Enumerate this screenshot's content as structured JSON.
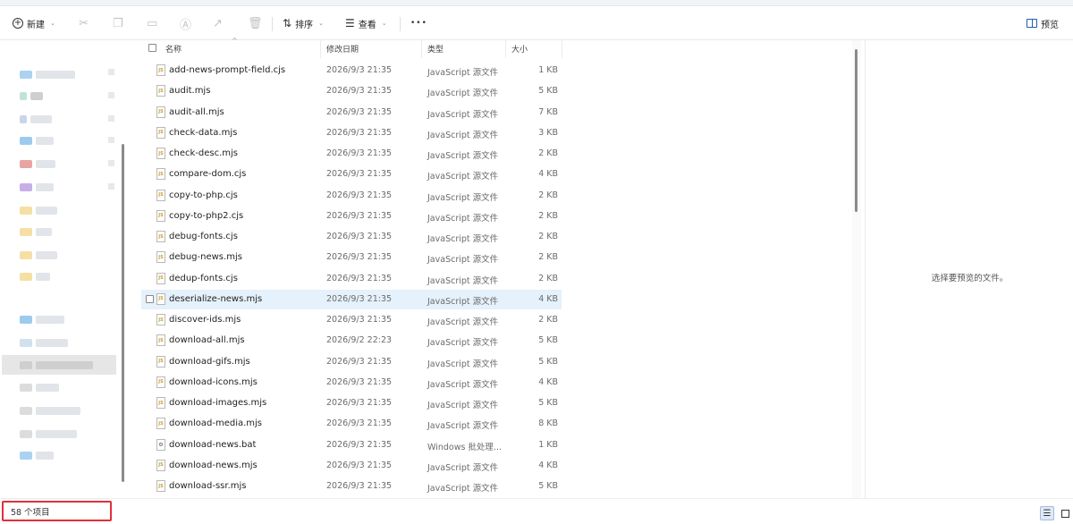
{
  "toolbar": {
    "new_label": "新建",
    "sort_label": "排序",
    "view_label": "查看",
    "more_label": "•••",
    "preview_label": "预览"
  },
  "columns": {
    "name": "名称",
    "date": "修改日期",
    "type": "类型",
    "size": "大小"
  },
  "files": [
    {
      "name": "add-news-prompt-field.cjs",
      "date": "2026/9/3 21:35",
      "type": "JavaScript 源文件",
      "size": "1 KB",
      "icon": "js-file-icon"
    },
    {
      "name": "audit.mjs",
      "date": "2026/9/3 21:35",
      "type": "JavaScript 源文件",
      "size": "5 KB",
      "icon": "js-file-icon"
    },
    {
      "name": "audit-all.mjs",
      "date": "2026/9/3 21:35",
      "type": "JavaScript 源文件",
      "size": "7 KB",
      "icon": "js-file-icon"
    },
    {
      "name": "check-data.mjs",
      "date": "2026/9/3 21:35",
      "type": "JavaScript 源文件",
      "size": "3 KB",
      "icon": "js-file-icon"
    },
    {
      "name": "check-desc.mjs",
      "date": "2026/9/3 21:35",
      "type": "JavaScript 源文件",
      "size": "2 KB",
      "icon": "js-file-icon"
    },
    {
      "name": "compare-dom.cjs",
      "date": "2026/9/3 21:35",
      "type": "JavaScript 源文件",
      "size": "4 KB",
      "icon": "js-file-icon"
    },
    {
      "name": "copy-to-php.cjs",
      "date": "2026/9/3 21:35",
      "type": "JavaScript 源文件",
      "size": "2 KB",
      "icon": "js-file-icon"
    },
    {
      "name": "copy-to-php2.cjs",
      "date": "2026/9/3 21:35",
      "type": "JavaScript 源文件",
      "size": "2 KB",
      "icon": "js-file-icon"
    },
    {
      "name": "debug-fonts.cjs",
      "date": "2026/9/3 21:35",
      "type": "JavaScript 源文件",
      "size": "2 KB",
      "icon": "js-file-icon"
    },
    {
      "name": "debug-news.mjs",
      "date": "2026/9/3 21:35",
      "type": "JavaScript 源文件",
      "size": "2 KB",
      "icon": "js-file-icon"
    },
    {
      "name": "dedup-fonts.cjs",
      "date": "2026/9/3 21:35",
      "type": "JavaScript 源文件",
      "size": "2 KB",
      "icon": "js-file-icon"
    },
    {
      "name": "deserialize-news.mjs",
      "date": "2026/9/3 21:35",
      "type": "JavaScript 源文件",
      "size": "4 KB",
      "icon": "js-file-icon"
    },
    {
      "name": "discover-ids.mjs",
      "date": "2026/9/3 21:35",
      "type": "JavaScript 源文件",
      "size": "2 KB",
      "icon": "js-file-icon"
    },
    {
      "name": "download-all.mjs",
      "date": "2026/9/2 22:23",
      "type": "JavaScript 源文件",
      "size": "5 KB",
      "icon": "js-file-icon"
    },
    {
      "name": "download-gifs.mjs",
      "date": "2026/9/3 21:35",
      "type": "JavaScript 源文件",
      "size": "5 KB",
      "icon": "js-file-icon"
    },
    {
      "name": "download-icons.mjs",
      "date": "2026/9/3 21:35",
      "type": "JavaScript 源文件",
      "size": "4 KB",
      "icon": "js-file-icon"
    },
    {
      "name": "download-images.mjs",
      "date": "2026/9/3 21:35",
      "type": "JavaScript 源文件",
      "size": "5 KB",
      "icon": "js-file-icon"
    },
    {
      "name": "download-media.mjs",
      "date": "2026/9/3 21:35",
      "type": "JavaScript 源文件",
      "size": "8 KB",
      "icon": "js-file-icon"
    },
    {
      "name": "download-news.bat",
      "date": "2026/9/3 21:35",
      "type": "Windows 批处理...",
      "size": "1 KB",
      "icon": "bat-file-icon"
    },
    {
      "name": "download-news.mjs",
      "date": "2026/9/3 21:35",
      "type": "JavaScript 源文件",
      "size": "4 KB",
      "icon": "js-file-icon"
    },
    {
      "name": "download-ssr.mjs",
      "date": "2026/9/3 21:35",
      "type": "JavaScript 源文件",
      "size": "5 KB",
      "icon": "js-file-icon"
    }
  ],
  "highlighted_index": 11,
  "preview": {
    "empty_message": "选择要预览的文件。"
  },
  "status": {
    "item_count": "58 个项目"
  },
  "colors": {
    "highlight": "#e5f1fb",
    "status_outline": "#e0303a"
  }
}
